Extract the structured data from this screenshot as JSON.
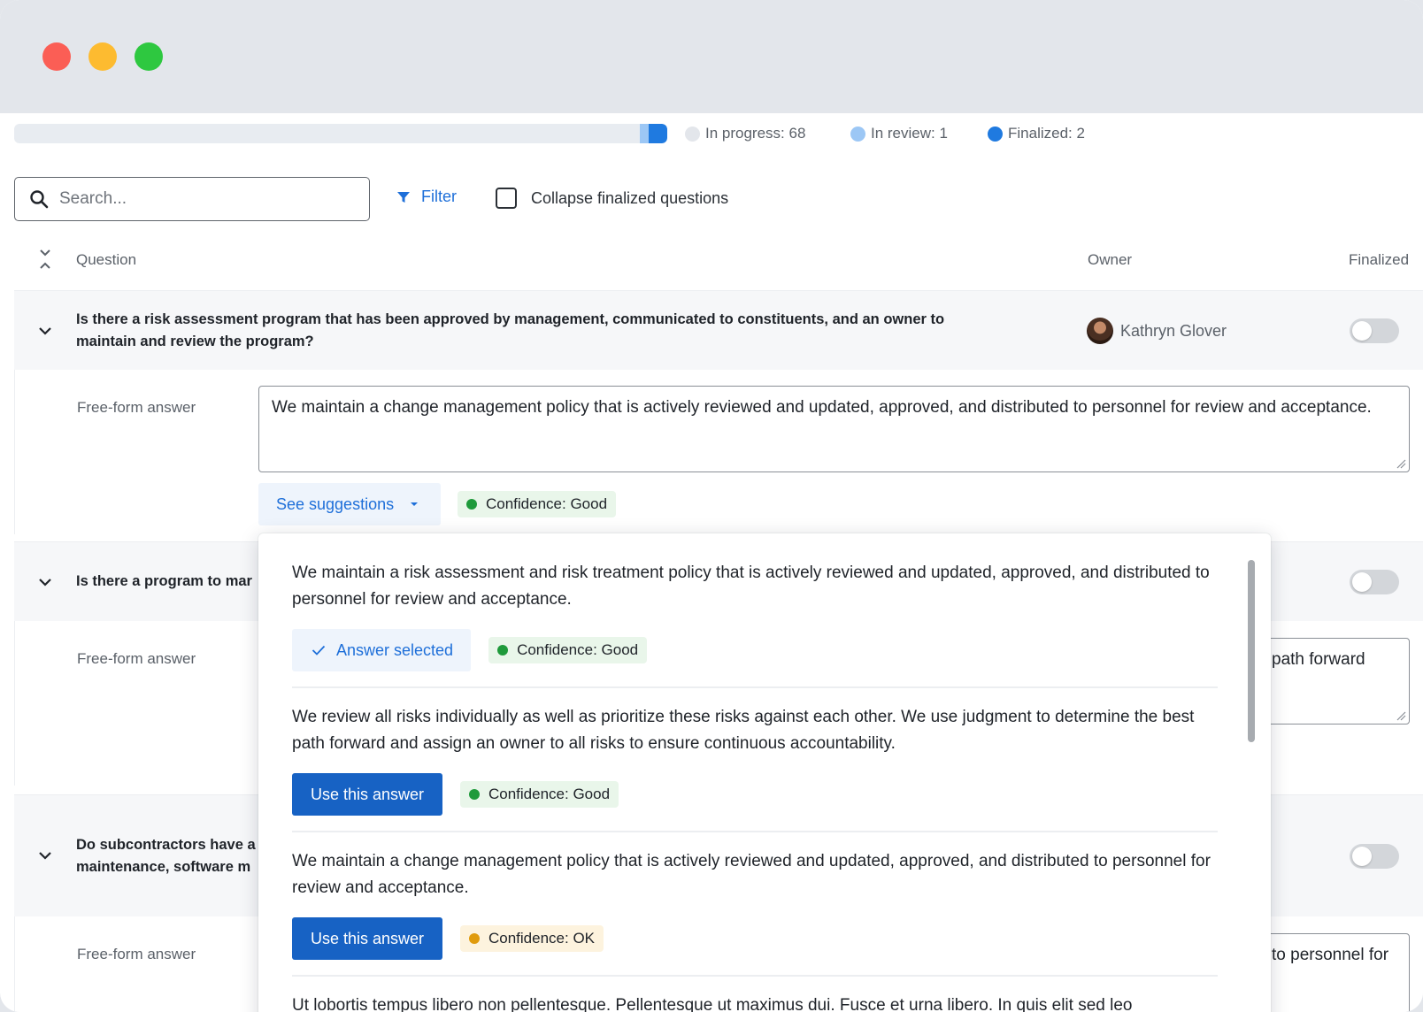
{
  "progress": {
    "in_progress_count": 68,
    "in_review_count": 1,
    "finalized_count": 2,
    "legend": [
      {
        "label": "In progress: 68",
        "color": "#e3e6eb"
      },
      {
        "label": "In review: 1",
        "color": "#9cc7f5"
      },
      {
        "label": "Finalized: 2",
        "color": "#1f7ae0"
      }
    ]
  },
  "toolbar": {
    "search_placeholder": "Search...",
    "filter_label": "Filter",
    "collapse_label": "Collapse finalized questions"
  },
  "columns": {
    "question": "Question",
    "owner": "Owner",
    "finalized": "Finalized"
  },
  "questions": [
    {
      "text": "Is there a risk assessment program that has been approved by management, communicated to constituents, and an owner to maintain and review the program?",
      "line1": "Is there a risk assessment program that has been approved by management, communicated to constituents, and an owner to",
      "line2": "maintain and review the program?",
      "owner": "Kathryn Glover",
      "finalized": false,
      "answer_label": "Free-form answer",
      "answer": "We maintain a change management policy that is actively reviewed and updated, approved, and distributed to personnel for review and acceptance.",
      "suggestions_label": "See suggestions",
      "confidence": "Confidence: Good"
    },
    {
      "line1": "Is there a program to mar",
      "finalized": false,
      "answer_label": "Free-form answer",
      "answer_visible": "path forward"
    },
    {
      "line1": "Do subcontractors have a",
      "line2": "maintenance, software m",
      "finalized": false,
      "answer_label": "Free-form answer",
      "answer_visible": "to personnel for"
    }
  ],
  "suggestions": [
    {
      "text": "We maintain a risk assessment and risk treatment policy that is actively reviewed and updated, approved, and distributed to personnel for review and acceptance.",
      "action": "Answer selected",
      "confidence": "Confidence: Good",
      "level": "good"
    },
    {
      "text": "We review all risks individually as well as prioritize these risks against each other. We use judgment to determine the best path forward and assign an owner to all risks to ensure continuous accountability.",
      "action": "Use this answer",
      "confidence": "Confidence: Good",
      "level": "good"
    },
    {
      "text": "We maintain a change management policy that is actively reviewed and updated, approved, and distributed to personnel for review and acceptance.",
      "action": "Use this answer",
      "confidence": "Confidence: OK",
      "level": "ok"
    },
    {
      "text": "Ut lobortis tempus libero non pellentesque. Pellentesque ut maximus dui. Fusce et urna libero. In quis elit sed leo"
    }
  ]
}
